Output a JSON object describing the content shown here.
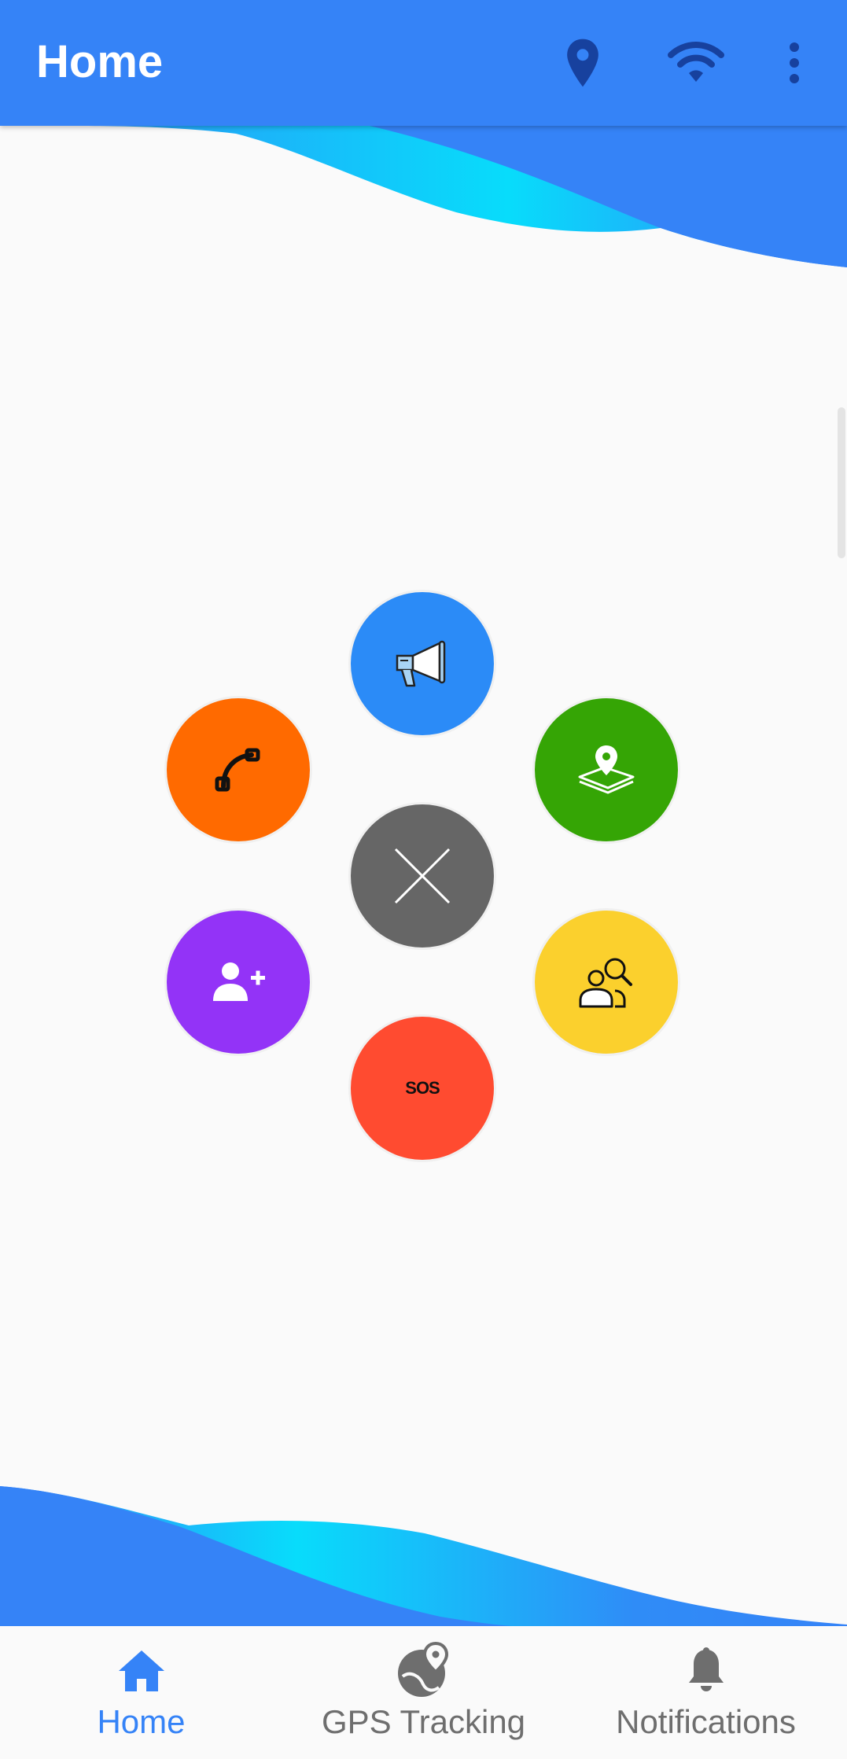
{
  "appbar": {
    "title": "Home",
    "icons": [
      "location-pin-icon",
      "wifi-icon",
      "more-vert-icon"
    ],
    "color": "#3583f7"
  },
  "menu": {
    "buttons": [
      {
        "name": "announcement-button",
        "icon": "megaphone-icon",
        "color": "#2b8bf7"
      },
      {
        "name": "call-button",
        "icon": "phone-icon",
        "color": "#ff6a00"
      },
      {
        "name": "map-location-button",
        "icon": "map-pin-icon",
        "color": "#35a505"
      },
      {
        "name": "close-menu-button",
        "icon": "close-icon",
        "color": "#666666"
      },
      {
        "name": "add-contact-button",
        "icon": "add-person-icon",
        "color": "#9333f7"
      },
      {
        "name": "find-people-button",
        "icon": "people-search-icon",
        "color": "#fbd02d"
      },
      {
        "name": "sos-button",
        "icon": "sos-icon",
        "color": "#ff4b30",
        "label": "SOS"
      }
    ]
  },
  "bottom_nav": {
    "items": [
      {
        "label": "Home",
        "icon": "home-icon",
        "active": true
      },
      {
        "label": "GPS Tracking",
        "icon": "gps-tracking-icon",
        "active": false
      },
      {
        "label": "Notifications",
        "icon": "bell-icon",
        "active": false
      }
    ],
    "active_color": "#3583f7",
    "inactive_color": "#6e6e6e"
  }
}
